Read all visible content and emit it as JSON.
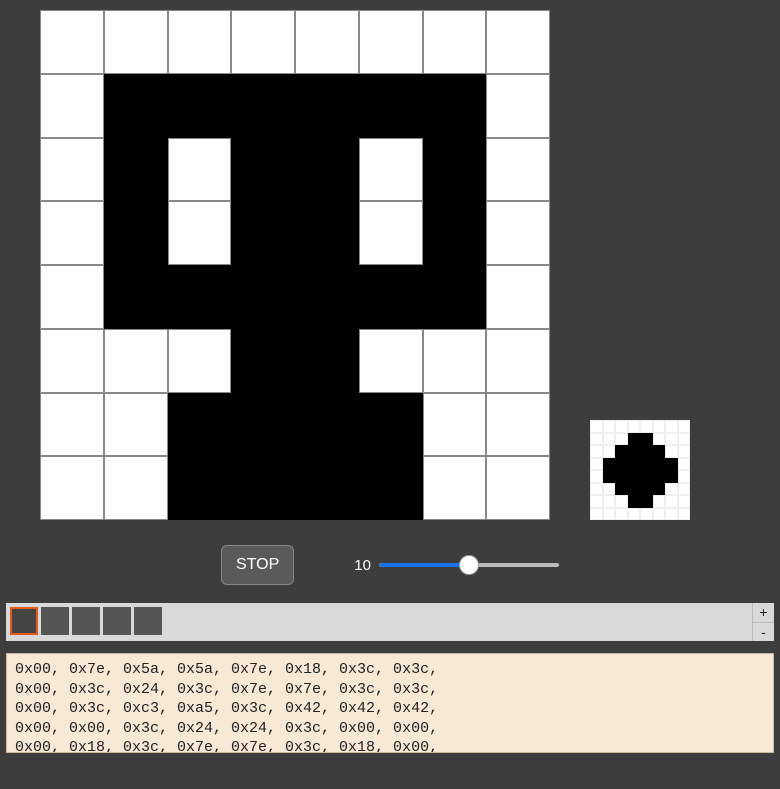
{
  "editor": {
    "grid_size": 8,
    "main_pattern_rows": [
      [
        0,
        0,
        0,
        0,
        0,
        0,
        0,
        0
      ],
      [
        0,
        1,
        1,
        1,
        1,
        1,
        1,
        0
      ],
      [
        0,
        1,
        0,
        1,
        1,
        0,
        1,
        0
      ],
      [
        0,
        1,
        0,
        1,
        1,
        0,
        1,
        0
      ],
      [
        0,
        1,
        1,
        1,
        1,
        1,
        1,
        0
      ],
      [
        0,
        0,
        0,
        1,
        1,
        0,
        0,
        0
      ],
      [
        0,
        0,
        1,
        1,
        1,
        1,
        0,
        0
      ],
      [
        0,
        0,
        1,
        1,
        1,
        1,
        0,
        0
      ]
    ],
    "preview_pattern_rows": [
      [
        0,
        0,
        0,
        0,
        0,
        0,
        0,
        0
      ],
      [
        0,
        0,
        0,
        1,
        1,
        0,
        0,
        0
      ],
      [
        0,
        0,
        1,
        1,
        1,
        1,
        0,
        0
      ],
      [
        0,
        1,
        1,
        1,
        1,
        1,
        1,
        0
      ],
      [
        0,
        1,
        1,
        1,
        1,
        1,
        1,
        0
      ],
      [
        0,
        0,
        1,
        1,
        1,
        1,
        0,
        0
      ],
      [
        0,
        0,
        0,
        1,
        1,
        0,
        0,
        0
      ],
      [
        0,
        0,
        0,
        0,
        0,
        0,
        0,
        0
      ]
    ]
  },
  "controls": {
    "stop_label": "STOP",
    "speed_value": "10",
    "slider_percent": 50
  },
  "frames": {
    "count": 5,
    "selected_index": 0,
    "add_label": "+",
    "remove_label": "-"
  },
  "hex_output": {
    "lines": [
      "0x00, 0x7e, 0x5a, 0x5a, 0x7e, 0x18, 0x3c, 0x3c,",
      "0x00, 0x3c, 0x24, 0x3c, 0x7e, 0x7e, 0x3c, 0x3c,",
      "0x00, 0x3c, 0xc3, 0xa5, 0x3c, 0x42, 0x42, 0x42,",
      "0x00, 0x00, 0x3c, 0x24, 0x24, 0x3c, 0x00, 0x00,",
      "0x00, 0x18, 0x3c, 0x7e, 0x7e, 0x3c, 0x18, 0x00,"
    ]
  }
}
